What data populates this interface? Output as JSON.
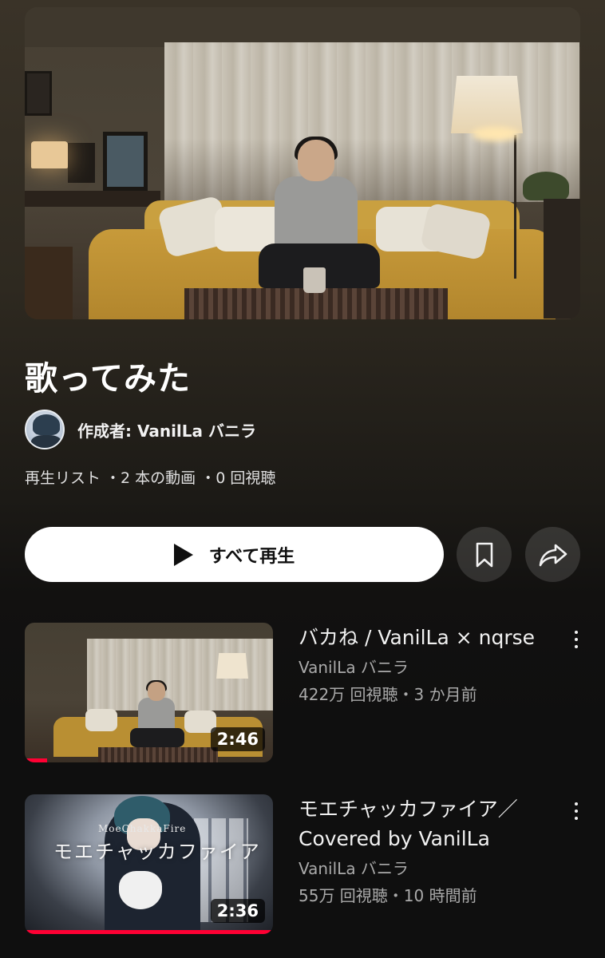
{
  "playlist": {
    "title": "歌ってみた",
    "author_label": "作成者: VanilLa バニラ",
    "meta": "再生リスト ・2 本の動画 ・0 回視聴",
    "play_all_label": "すべて再生"
  },
  "icons": {
    "play": "play-icon",
    "save": "bookmark-icon",
    "share": "share-arrow-icon",
    "more": "more-vert-icon"
  },
  "colors": {
    "progress": "#ff0033",
    "play_button_bg": "#ffffff"
  },
  "videos": [
    {
      "title": "バカね / VanilLa × nqrse",
      "channel": "VanilLa バニラ",
      "stats": "422万 回視聴・3 か月前",
      "duration": "2:46",
      "progress": 0.09
    },
    {
      "title": "モエチャッカファイア／ Covered by VanilLa",
      "channel": "VanilLa バニラ",
      "stats": "55万 回視聴・10 時間前",
      "duration": "2:36",
      "progress": 1.0,
      "thumb_text_main": "モエチャッカファイア",
      "thumb_text_small": "MoeChakkaFire"
    }
  ]
}
